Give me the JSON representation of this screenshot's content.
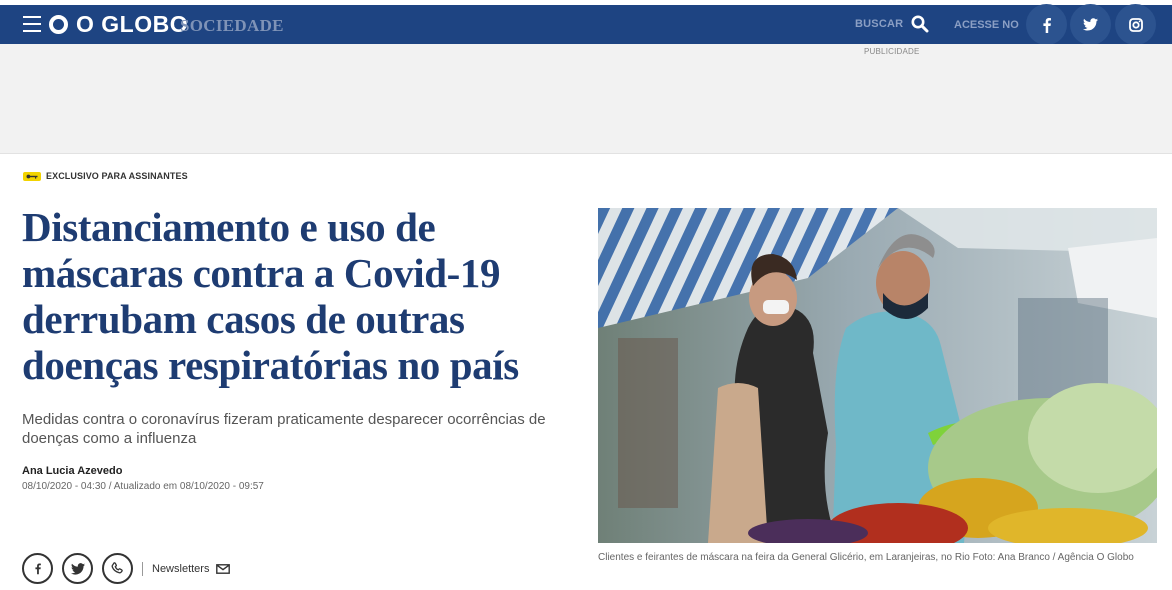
{
  "header": {
    "logo": "O GLOBO",
    "section": "SOCIEDADE",
    "search_label": "BUSCAR",
    "access_label": "ACESSE NO",
    "social": [
      "facebook-icon",
      "twitter-icon",
      "instagram-icon"
    ],
    "colors": {
      "bar": "#1e4482",
      "social_circle": "#2c538f",
      "muted_text": "#8b9fc4"
    }
  },
  "ad": {
    "label": "PUBLICIDADE"
  },
  "article": {
    "exclusive_label": "EXCLUSIVO PARA ASSINANTES",
    "headline": "Distanciamento e uso de máscaras contra a Covid-19 derrubam casos de outras doenças respiratórias no país",
    "subheadline": "Medidas contra o coronavírus fizeram praticamente desparecer ocorrências de doenças como a influenza",
    "author": "Ana Lucia Azevedo",
    "dates": "08/10/2020 - 04:30 / Atualizado em 08/10/2020 - 09:57",
    "headline_color": "#1e3c72",
    "badge_color": "#f2d300"
  },
  "share": {
    "icons": [
      "facebook-icon",
      "twitter-icon",
      "whatsapp-icon"
    ],
    "newsletters_label": "Newsletters"
  },
  "photo": {
    "caption": "Clientes e feirantes de máscara na feira da General Glicério, em Laranjeiras, no Rio Foto: Ana Branco / Agência O Globo"
  }
}
